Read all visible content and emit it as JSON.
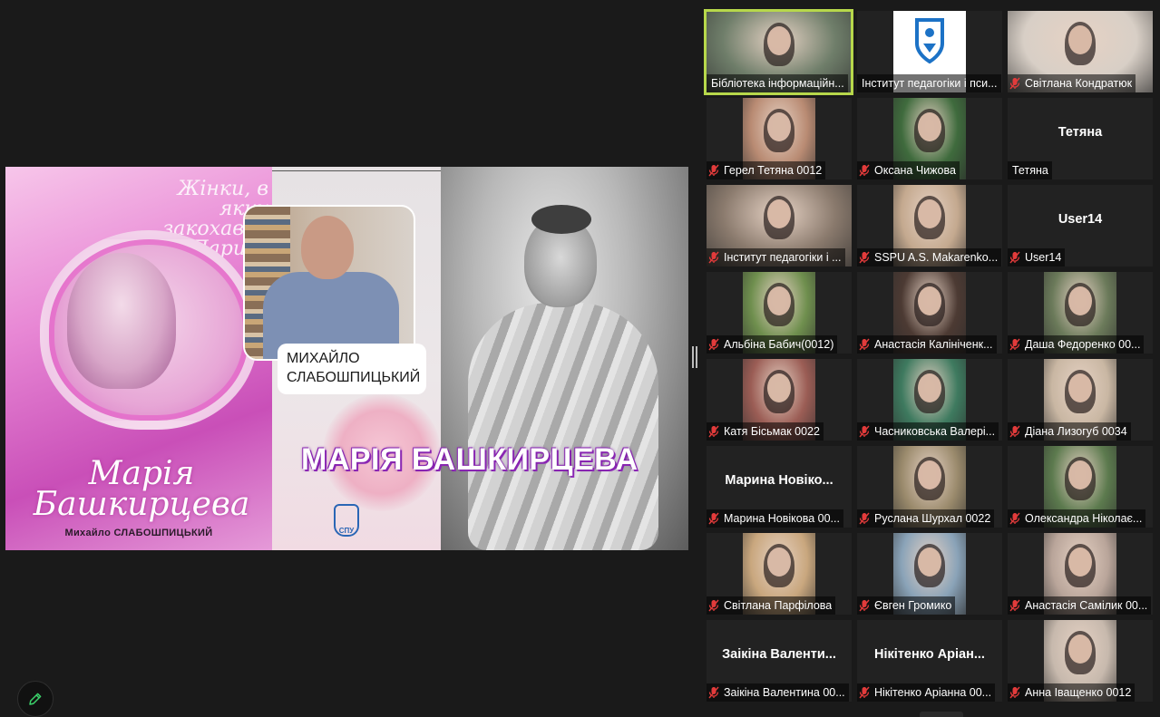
{
  "slide": {
    "book_script": "Жінки, в яких закохався Париж",
    "book_title_line1": "Марія",
    "book_title_line2": "Башкирцева",
    "book_author": "Михайло СЛАБОШПИЦЬКИЙ",
    "name_card_line1": "МИХАЙЛО",
    "name_card_line2": "СЛАБОШПИЦЬКИЙ",
    "main_title": "МАРІЯ БАШКИРЦЕВА",
    "logo_text": "СПУ"
  },
  "participants": [
    {
      "name": "Бібліотека інформаційн...",
      "muted": false,
      "active": true,
      "thumb": "video",
      "tone": "#6f7e6a"
    },
    {
      "name": "Інститут педагогіки і пси...",
      "muted": false,
      "active": false,
      "thumb": "logo",
      "tone": "#ffffff"
    },
    {
      "name": "Світлана Кондратюк",
      "muted": true,
      "active": false,
      "thumb": "video",
      "tone": "#d8cfc6"
    },
    {
      "name": "Герел Тетяна 0012",
      "muted": true,
      "active": false,
      "thumb": "video",
      "tone": "#b98b73"
    },
    {
      "name": "Оксана Чижова",
      "muted": true,
      "active": false,
      "thumb": "video",
      "tone": "#3f6b3d"
    },
    {
      "name": "Тетяна",
      "muted": false,
      "active": false,
      "thumb": "none",
      "center": "Тетяна"
    },
    {
      "name": "Інститут педагогіки і ...",
      "muted": true,
      "active": false,
      "thumb": "video",
      "tone": "#8a7a6d"
    },
    {
      "name": "SSPU A.S. Makarenko...",
      "muted": true,
      "active": false,
      "thumb": "video",
      "tone": "#c4a98f"
    },
    {
      "name": "User14",
      "muted": true,
      "active": false,
      "thumb": "none",
      "center": "User14"
    },
    {
      "name": "Альбіна Бабич(0012)",
      "muted": true,
      "active": false,
      "thumb": "video",
      "tone": "#6f8f4e"
    },
    {
      "name": "Анастасія Калініченк...",
      "muted": true,
      "active": false,
      "thumb": "video",
      "tone": "#4c3a33"
    },
    {
      "name": "Даша Федоренко 00...",
      "muted": true,
      "active": false,
      "thumb": "video",
      "tone": "#6b7a5a"
    },
    {
      "name": "Катя Бісьмак 0022",
      "muted": true,
      "active": false,
      "thumb": "video",
      "tone": "#9b5d55"
    },
    {
      "name": "Часниковська Валері...",
      "muted": true,
      "active": false,
      "thumb": "video",
      "tone": "#3e7a5f"
    },
    {
      "name": "Діана Лизогуб 0034",
      "muted": true,
      "active": false,
      "thumb": "video",
      "tone": "#c9b7a3"
    },
    {
      "name": "Марина Новікова 00...",
      "muted": true,
      "active": false,
      "thumb": "none",
      "center": "Марина Новіко..."
    },
    {
      "name": "Руслана Шурхал 0022",
      "muted": true,
      "active": false,
      "thumb": "video",
      "tone": "#9a8a6c"
    },
    {
      "name": "Олександра Ніколає...",
      "muted": true,
      "active": false,
      "thumb": "video",
      "tone": "#5c7a4e"
    },
    {
      "name": "Світлана Парфілова",
      "muted": true,
      "active": false,
      "thumb": "video",
      "tone": "#c9a77e"
    },
    {
      "name": "Євген Громико",
      "muted": true,
      "active": false,
      "thumb": "video",
      "tone": "#8aa3b8"
    },
    {
      "name": "Анастасія Самілик 00...",
      "muted": true,
      "active": false,
      "thumb": "video",
      "tone": "#b9a59a"
    },
    {
      "name": "Заікіна Валентина 00...",
      "muted": true,
      "active": false,
      "thumb": "none",
      "center": "Заікіна Валенти..."
    },
    {
      "name": "Нікітенко Аріанна 00...",
      "muted": true,
      "active": false,
      "thumb": "none",
      "center": "Нікітенко Аріан..."
    },
    {
      "name": "Анна Іващенко 0012",
      "muted": true,
      "active": false,
      "thumb": "video",
      "tone": "#c7b9ad"
    }
  ],
  "icons": {
    "mic": "mic-muted-icon",
    "annotate": "pencil-icon"
  },
  "colors": {
    "active_border": "#b7d84b",
    "muted_red": "#e23b3b",
    "title_purple": "#8e2ab8"
  }
}
